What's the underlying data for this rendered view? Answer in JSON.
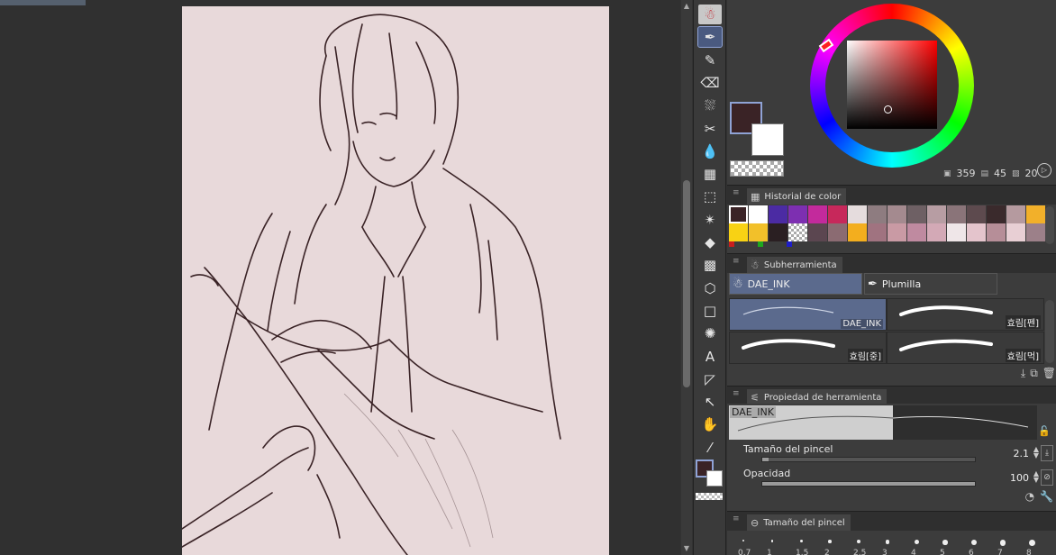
{
  "tools": [
    {
      "name": "tool-mascot-icon",
      "glyph": "☃"
    },
    {
      "name": "tool-pen-icon",
      "glyph": "✒"
    },
    {
      "name": "tool-marker-icon",
      "glyph": "✎"
    },
    {
      "name": "tool-eraser-icon",
      "glyph": "⌫"
    },
    {
      "name": "tool-airbrush-icon",
      "glyph": "⛆"
    },
    {
      "name": "tool-decoration-icon",
      "glyph": "✂"
    },
    {
      "name": "tool-blend-icon",
      "glyph": "💧"
    },
    {
      "name": "tool-grid-icon",
      "glyph": "▦"
    },
    {
      "name": "tool-lasso-icon",
      "glyph": "⬚"
    },
    {
      "name": "tool-magic-wand-icon",
      "glyph": "✴"
    },
    {
      "name": "tool-fill-icon",
      "glyph": "◆"
    },
    {
      "name": "tool-gradient-icon",
      "glyph": "▩"
    },
    {
      "name": "tool-3d-icon",
      "glyph": "⬡"
    },
    {
      "name": "tool-rectangle-icon",
      "glyph": "□"
    },
    {
      "name": "tool-rays-icon",
      "glyph": "✺"
    },
    {
      "name": "tool-text-icon",
      "glyph": "A"
    },
    {
      "name": "tool-balloon-icon",
      "glyph": "◸"
    },
    {
      "name": "tool-object-select-icon",
      "glyph": "↖"
    },
    {
      "name": "tool-hand-icon",
      "glyph": "✋"
    },
    {
      "name": "tool-eyedropper-icon",
      "glyph": "⁄"
    }
  ],
  "colors": {
    "main": "#3a2326",
    "sub": "#ffffff",
    "paper": "#e8d9da"
  },
  "color_wheel": {
    "h": "359",
    "s": "45",
    "v": "20"
  },
  "history": {
    "tab_label": "Historial de color",
    "row1": [
      "#3a2326",
      "#ffffff",
      "#4b2ba3",
      "#7d2fb1",
      "#c32a9c",
      "#c7285b",
      "#e5dcdd",
      "#8e7c80",
      "#a48a8f",
      "#6e6064",
      "#b79da3",
      "#8a7479",
      "#5d4a4e",
      "#3a2a2c",
      "#b59a9f",
      "#f2b02a"
    ],
    "row2": [
      "#f8d214",
      "#f2c02a",
      "#2a1f22",
      "checker",
      "#5b4650",
      "#8b6b72",
      "#f3ae1e",
      "#a07380",
      "#c99aa4",
      "#bf8aa0",
      "#d3a9b6",
      "#efe6e8",
      "#e4c4cc",
      "#b68e98",
      "#e8cfd4",
      "#9c8089"
    ],
    "dots": [
      "#c81e1e",
      "#1ea81e",
      "#1e1ec8"
    ]
  },
  "subtool": {
    "tab_label": "Subherramienta",
    "groups": [
      "DAE_INK",
      "Plumilla"
    ],
    "brushes": [
      "DAE_INK",
      "효림[펜]",
      "효림[중]",
      "효림[먹]"
    ]
  },
  "toolprop": {
    "tab_label": "Propiedad de herramienta",
    "preset_name": "DAE_INK",
    "brush_size_label": "Tamaño del pincel",
    "brush_size_value": "2.1",
    "brush_size_fraction": 0.03,
    "opacity_label": "Opacidad",
    "opacity_value": "100",
    "opacity_fraction": 1.0
  },
  "brushsize_panel": {
    "tab_label": "Tamaño del pincel",
    "sizes": [
      "0.7",
      "1",
      "1.5",
      "2",
      "2.5",
      "3",
      "4",
      "5",
      "6",
      "7",
      "8"
    ]
  }
}
